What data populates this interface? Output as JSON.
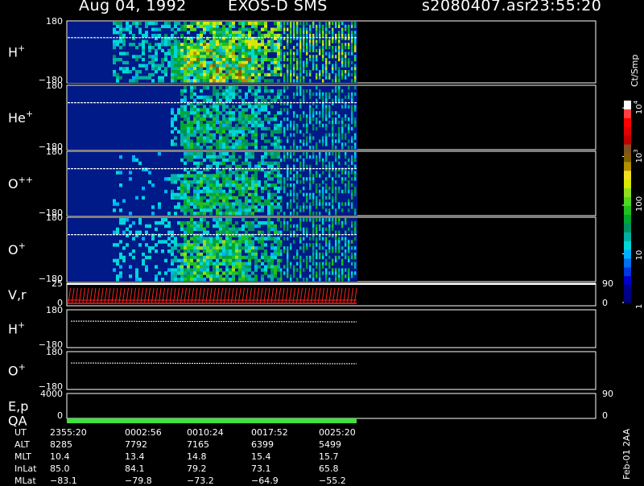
{
  "header": {
    "date": "Aug 04, 1992",
    "mission": "EXOS-D SMS",
    "file": "s2080407.asr",
    "time": "23:55:20"
  },
  "chart_data": {
    "type": "heatmap",
    "panels": [
      {
        "label": "H",
        "sup": "+",
        "ytop": "180",
        "ybot": "−180",
        "kind": "spectrogram",
        "activity": 1.0
      },
      {
        "label": "He",
        "sup": "+",
        "ytop": "180",
        "ybot": "−180",
        "kind": "spectrogram",
        "activity": 0.55
      },
      {
        "label": "O",
        "sup": "++",
        "ytop": "180",
        "ybot": "−180",
        "kind": "spectrogram",
        "activity": 0.6
      },
      {
        "label": "O",
        "sup": "+",
        "ytop": "180",
        "ybot": "−180",
        "kind": "spectrogram",
        "activity": 0.7
      },
      {
        "label": "V,r",
        "sup": "",
        "ytop": "25",
        "ybot": "0",
        "kind": "velocity",
        "right_top": "90",
        "right_bot": "0"
      },
      {
        "label": "H",
        "sup": "+",
        "ytop": "180",
        "ybot": "−180",
        "kind": "angle"
      },
      {
        "label": "O",
        "sup": "+",
        "ytop": "180",
        "ybot": "−180",
        "kind": "angle"
      },
      {
        "label": "E,p",
        "label2": "QA",
        "sup": "",
        "ytop": "4000",
        "ybot": "0",
        "kind": "energy",
        "right_top": "90",
        "right_bot": "0"
      }
    ],
    "colorbar": {
      "label": "Ct/Smp",
      "ticks": [
        {
          "text": "1",
          "v": 0
        },
        {
          "text": "10",
          "v": 1
        },
        {
          "text": "100",
          "v": 2
        },
        {
          "text": "10",
          "sup": "3",
          "v": 3
        },
        {
          "text": "10",
          "sup": "4",
          "v": 4
        }
      ],
      "colors": [
        "#000080",
        "#00008b",
        "#0000c8",
        "#0038e0",
        "#0070f0",
        "#00b0ff",
        "#00d8d8",
        "#00b0a0",
        "#009060",
        "#00a830",
        "#20c020",
        "#50d820",
        "#90e020",
        "#d8e800",
        "#f0e020",
        "#b09000",
        "#806000",
        "#805020",
        "#c00000",
        "#e00000",
        "#ff0000",
        "#ff4040",
        "#ffffff"
      ]
    }
  },
  "footer": {
    "rows": [
      {
        "label": "UT",
        "values": [
          "2355:20",
          "0002:56",
          "0010:24",
          "0017:52",
          "0025:20"
        ]
      },
      {
        "label": "ALT",
        "values": [
          "8285",
          "7792",
          "7165",
          "6399",
          "5499"
        ]
      },
      {
        "label": "MLT",
        "values": [
          "10.4",
          "13.4",
          "14.8",
          "15.4",
          "15.7"
        ]
      },
      {
        "label": "InLat",
        "values": [
          "85.0",
          "84.1",
          "79.2",
          "73.1",
          "65.8"
        ]
      },
      {
        "label": "MLat",
        "values": [
          "−83.1",
          "−79.8",
          "−73.2",
          "−64.9",
          "−55.2"
        ]
      }
    ],
    "stamp": "Feb-01 2AA"
  }
}
